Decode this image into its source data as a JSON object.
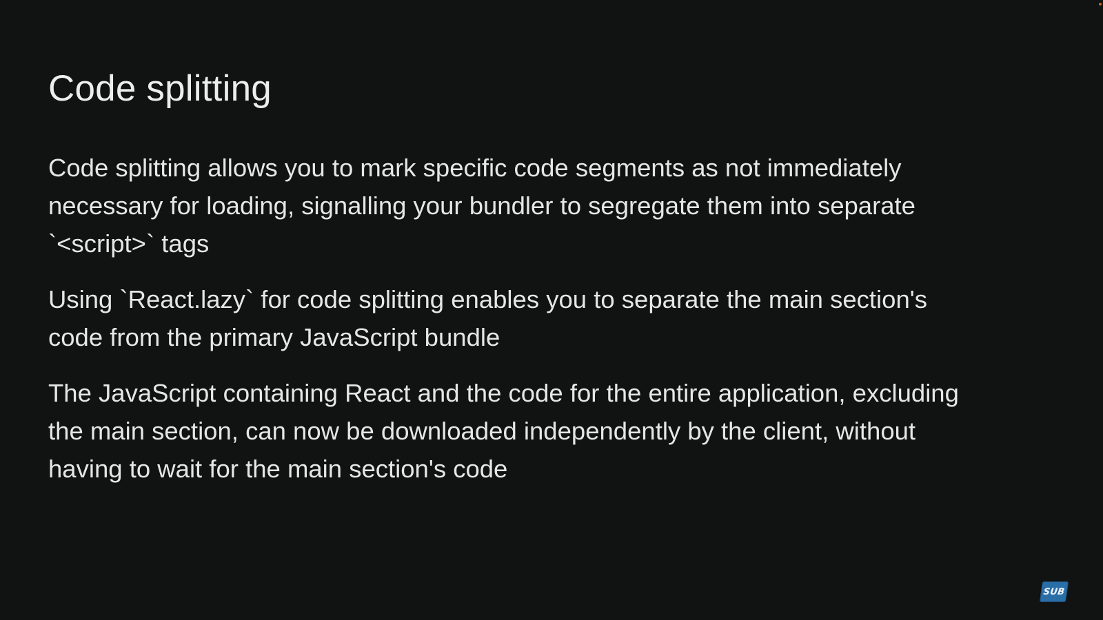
{
  "slide": {
    "title": "Code splitting",
    "paragraphs": [
      "Code splitting allows you to mark specific code segments as not immediately\nnecessary for loading, signalling your bundler to segregate them into separate\n`<script>` tags",
      "Using `React.lazy` for code splitting enables you to separate the main section's\ncode from the primary JavaScript bundle",
      "The JavaScript containing React and the code for the entire application, excluding\nthe main section, can now be downloaded independently by the client, without\nhaving to wait for the main section's code"
    ]
  },
  "badge": {
    "label": "SUB",
    "color": "#2a6ea8"
  },
  "colors": {
    "background": "#111212",
    "text": "#e6e6e6"
  }
}
